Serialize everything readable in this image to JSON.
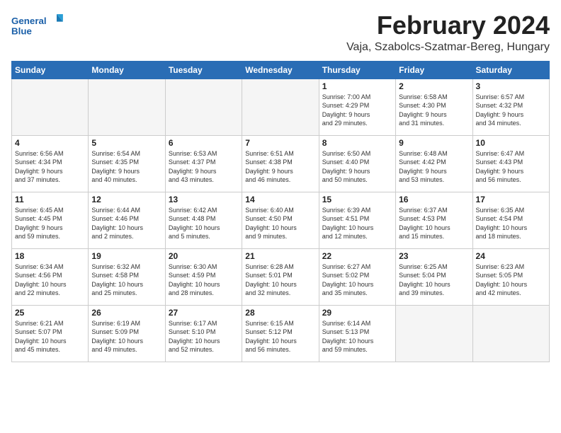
{
  "logo": {
    "line1": "General",
    "line2": "Blue"
  },
  "title": "February 2024",
  "location": "Vaja, Szabolcs-Szatmar-Bereg, Hungary",
  "weekdays": [
    "Sunday",
    "Monday",
    "Tuesday",
    "Wednesday",
    "Thursday",
    "Friday",
    "Saturday"
  ],
  "weeks": [
    [
      {
        "day": "",
        "info": ""
      },
      {
        "day": "",
        "info": ""
      },
      {
        "day": "",
        "info": ""
      },
      {
        "day": "",
        "info": ""
      },
      {
        "day": "1",
        "info": "Sunrise: 7:00 AM\nSunset: 4:29 PM\nDaylight: 9 hours\nand 29 minutes."
      },
      {
        "day": "2",
        "info": "Sunrise: 6:58 AM\nSunset: 4:30 PM\nDaylight: 9 hours\nand 31 minutes."
      },
      {
        "day": "3",
        "info": "Sunrise: 6:57 AM\nSunset: 4:32 PM\nDaylight: 9 hours\nand 34 minutes."
      }
    ],
    [
      {
        "day": "4",
        "info": "Sunrise: 6:56 AM\nSunset: 4:34 PM\nDaylight: 9 hours\nand 37 minutes."
      },
      {
        "day": "5",
        "info": "Sunrise: 6:54 AM\nSunset: 4:35 PM\nDaylight: 9 hours\nand 40 minutes."
      },
      {
        "day": "6",
        "info": "Sunrise: 6:53 AM\nSunset: 4:37 PM\nDaylight: 9 hours\nand 43 minutes."
      },
      {
        "day": "7",
        "info": "Sunrise: 6:51 AM\nSunset: 4:38 PM\nDaylight: 9 hours\nand 46 minutes."
      },
      {
        "day": "8",
        "info": "Sunrise: 6:50 AM\nSunset: 4:40 PM\nDaylight: 9 hours\nand 50 minutes."
      },
      {
        "day": "9",
        "info": "Sunrise: 6:48 AM\nSunset: 4:42 PM\nDaylight: 9 hours\nand 53 minutes."
      },
      {
        "day": "10",
        "info": "Sunrise: 6:47 AM\nSunset: 4:43 PM\nDaylight: 9 hours\nand 56 minutes."
      }
    ],
    [
      {
        "day": "11",
        "info": "Sunrise: 6:45 AM\nSunset: 4:45 PM\nDaylight: 9 hours\nand 59 minutes."
      },
      {
        "day": "12",
        "info": "Sunrise: 6:44 AM\nSunset: 4:46 PM\nDaylight: 10 hours\nand 2 minutes."
      },
      {
        "day": "13",
        "info": "Sunrise: 6:42 AM\nSunset: 4:48 PM\nDaylight: 10 hours\nand 5 minutes."
      },
      {
        "day": "14",
        "info": "Sunrise: 6:40 AM\nSunset: 4:50 PM\nDaylight: 10 hours\nand 9 minutes."
      },
      {
        "day": "15",
        "info": "Sunrise: 6:39 AM\nSunset: 4:51 PM\nDaylight: 10 hours\nand 12 minutes."
      },
      {
        "day": "16",
        "info": "Sunrise: 6:37 AM\nSunset: 4:53 PM\nDaylight: 10 hours\nand 15 minutes."
      },
      {
        "day": "17",
        "info": "Sunrise: 6:35 AM\nSunset: 4:54 PM\nDaylight: 10 hours\nand 18 minutes."
      }
    ],
    [
      {
        "day": "18",
        "info": "Sunrise: 6:34 AM\nSunset: 4:56 PM\nDaylight: 10 hours\nand 22 minutes."
      },
      {
        "day": "19",
        "info": "Sunrise: 6:32 AM\nSunset: 4:58 PM\nDaylight: 10 hours\nand 25 minutes."
      },
      {
        "day": "20",
        "info": "Sunrise: 6:30 AM\nSunset: 4:59 PM\nDaylight: 10 hours\nand 28 minutes."
      },
      {
        "day": "21",
        "info": "Sunrise: 6:28 AM\nSunset: 5:01 PM\nDaylight: 10 hours\nand 32 minutes."
      },
      {
        "day": "22",
        "info": "Sunrise: 6:27 AM\nSunset: 5:02 PM\nDaylight: 10 hours\nand 35 minutes."
      },
      {
        "day": "23",
        "info": "Sunrise: 6:25 AM\nSunset: 5:04 PM\nDaylight: 10 hours\nand 39 minutes."
      },
      {
        "day": "24",
        "info": "Sunrise: 6:23 AM\nSunset: 5:05 PM\nDaylight: 10 hours\nand 42 minutes."
      }
    ],
    [
      {
        "day": "25",
        "info": "Sunrise: 6:21 AM\nSunset: 5:07 PM\nDaylight: 10 hours\nand 45 minutes."
      },
      {
        "day": "26",
        "info": "Sunrise: 6:19 AM\nSunset: 5:09 PM\nDaylight: 10 hours\nand 49 minutes."
      },
      {
        "day": "27",
        "info": "Sunrise: 6:17 AM\nSunset: 5:10 PM\nDaylight: 10 hours\nand 52 minutes."
      },
      {
        "day": "28",
        "info": "Sunrise: 6:15 AM\nSunset: 5:12 PM\nDaylight: 10 hours\nand 56 minutes."
      },
      {
        "day": "29",
        "info": "Sunrise: 6:14 AM\nSunset: 5:13 PM\nDaylight: 10 hours\nand 59 minutes."
      },
      {
        "day": "",
        "info": ""
      },
      {
        "day": "",
        "info": ""
      }
    ]
  ]
}
